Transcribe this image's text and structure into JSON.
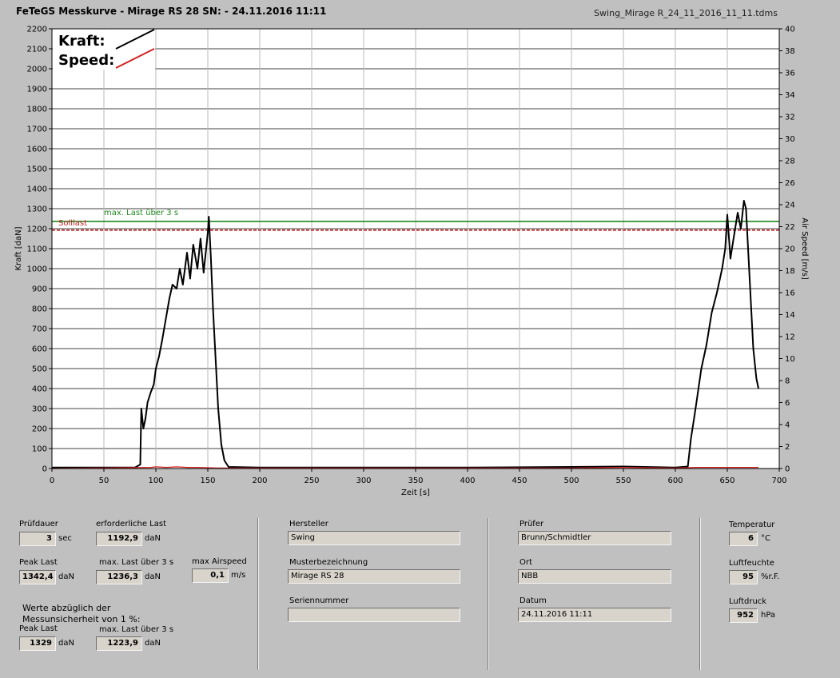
{
  "header": {
    "title": "FeTeGS Messkurve - Mirage RS 28  SN:  - 24.11.2016 11:11",
    "file": "Swing_Mirage R_24_11_2016_11_11.tdms"
  },
  "chart_data": {
    "type": "line",
    "xlabel": "Zeit [s]",
    "ylabel": "Kraft [daN]",
    "y2label": "Air Speed [m/s]",
    "xlim": [
      0,
      700
    ],
    "ylim": [
      0,
      2200
    ],
    "y2lim": [
      0,
      40
    ],
    "xticks": [
      0,
      50,
      100,
      150,
      200,
      250,
      300,
      350,
      400,
      450,
      500,
      550,
      600,
      650,
      700
    ],
    "yticks": [
      0,
      100,
      200,
      300,
      400,
      500,
      600,
      700,
      800,
      900,
      1000,
      1100,
      1200,
      1300,
      1400,
      1500,
      1600,
      1700,
      1800,
      1900,
      2000,
      2100,
      2200
    ],
    "y2ticks": [
      0,
      2,
      4,
      6,
      8,
      10,
      12,
      14,
      16,
      18,
      20,
      22,
      24,
      26,
      28,
      30,
      32,
      34,
      36,
      38,
      40
    ],
    "grid": true,
    "legend_position": "top-left",
    "legend": [
      {
        "label": "Kraft:",
        "color": "#000000"
      },
      {
        "label": "Speed:",
        "color": "#d42020"
      }
    ],
    "reference_lines": [
      {
        "label": "max. Last über  3 s",
        "value": 1236.3,
        "color": "#1f8a1f",
        "style": "solid"
      },
      {
        "label": "Solllast",
        "value": 1192.9,
        "color": "#c02020",
        "style": "dashed"
      }
    ],
    "series": [
      {
        "name": "Kraft:",
        "color": "#000000",
        "axis": "left",
        "x": [
          0,
          80,
          85,
          86,
          88,
          90,
          92,
          95,
          98,
          100,
          103,
          106,
          110,
          113,
          116,
          120,
          123,
          126,
          130,
          133,
          136,
          140,
          143,
          146,
          150,
          151,
          153,
          155,
          158,
          160,
          163,
          166,
          170,
          200,
          300,
          400,
          500,
          550,
          600,
          612,
          615,
          618,
          620,
          625,
          630,
          635,
          640,
          645,
          648,
          650,
          653,
          656,
          660,
          663,
          666,
          668,
          670,
          672,
          675,
          678,
          680
        ],
        "y": [
          5,
          5,
          20,
          300,
          200,
          250,
          330,
          380,
          420,
          500,
          560,
          640,
          760,
          850,
          920,
          900,
          1000,
          920,
          1080,
          950,
          1120,
          1000,
          1150,
          980,
          1180,
          1260,
          1050,
          800,
          500,
          300,
          120,
          40,
          8,
          5,
          5,
          5,
          8,
          10,
          5,
          10,
          150,
          250,
          320,
          500,
          620,
          780,
          880,
          1000,
          1100,
          1270,
          1050,
          1150,
          1280,
          1200,
          1340,
          1300,
          1100,
          900,
          600,
          450,
          400
        ]
      },
      {
        "name": "Speed:",
        "color": "#d42020",
        "axis": "right",
        "x": [
          0,
          95,
          100,
          110,
          120,
          130,
          140,
          160,
          200,
          300,
          400,
          500,
          550,
          600,
          620,
          680
        ],
        "y": [
          0,
          0.1,
          0.15,
          0.1,
          0.15,
          0.1,
          0.1,
          0.05,
          0.05,
          0.05,
          0.05,
          0.05,
          0.1,
          0.05,
          0.1,
          0.1
        ]
      }
    ]
  },
  "panel": {
    "pruefdauer": {
      "label": "Prüfdauer",
      "value": "3",
      "unit": "sec"
    },
    "erforderlich": {
      "label": "erforderliche Last",
      "value": "1192,9",
      "unit": "daN"
    },
    "peak": {
      "label": "Peak Last",
      "value": "1342,4",
      "unit": "daN"
    },
    "maxlast": {
      "label": "max. Last über  3 s",
      "value": "1236,3",
      "unit": "daN"
    },
    "airspeed": {
      "label": "max Airspeed",
      "value": "0,1",
      "unit": "m/s"
    },
    "werte_note": "Werte abzüglich der",
    "mess_note": "Messunsicherheit von 1  %:",
    "peak2": {
      "label": "Peak Last",
      "value": "1329",
      "unit": "daN"
    },
    "maxlast2": {
      "label": "max. Last über  3 s",
      "value": "1223,9",
      "unit": "daN"
    },
    "hersteller": {
      "label": "Hersteller",
      "value": "Swing"
    },
    "muster": {
      "label": "Musterbezeichnung",
      "value": "Mirage RS 28"
    },
    "serie": {
      "label": "Seriennummer",
      "value": ""
    },
    "pruefer": {
      "label": "Prüfer",
      "value": "Brunn/Schmidtler"
    },
    "ort": {
      "label": "Ort",
      "value": "NBB"
    },
    "datum": {
      "label": "Datum",
      "value": "24.11.2016 11:11"
    },
    "temperatur": {
      "label": "Temperatur",
      "value": "6",
      "unit": "°C"
    },
    "luftfeuchte": {
      "label": "Luftfeuchte",
      "value": "95",
      "unit": "%r.F."
    },
    "luftdruck": {
      "label": "Luftdruck",
      "value": "952",
      "unit": "hPa"
    }
  }
}
